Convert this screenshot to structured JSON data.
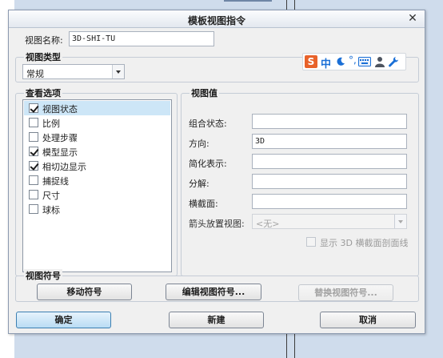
{
  "window": {
    "title": "模板视图指令",
    "close_glyph": "✕"
  },
  "view_name": {
    "label": "视图名称:",
    "value": "3D-SHI-TU"
  },
  "view_type": {
    "group_title": "视图类型",
    "selected": "常规"
  },
  "ime_toolbar": {
    "logo": "S",
    "mode": "中",
    "dot": "°,",
    "icons": [
      "sogou-logo-icon",
      "moon-icon",
      "punctuation-icon",
      "keyboard-icon",
      "user-icon",
      "wrench-icon"
    ],
    "accent": "#1a6fd6",
    "logo_color": "#e8622a"
  },
  "view_options": {
    "group_title": "查看选项",
    "items": [
      {
        "label": "视图状态",
        "checked": true,
        "selected": true
      },
      {
        "label": "比例",
        "checked": false,
        "selected": false
      },
      {
        "label": "处理步骤",
        "checked": false,
        "selected": false
      },
      {
        "label": "模型显示",
        "checked": true,
        "selected": false
      },
      {
        "label": "相切边显示",
        "checked": true,
        "selected": false
      },
      {
        "label": "捕捉线",
        "checked": false,
        "selected": false
      },
      {
        "label": "尺寸",
        "checked": false,
        "selected": false
      },
      {
        "label": "球标",
        "checked": false,
        "selected": false
      }
    ]
  },
  "view_values": {
    "group_title": "视图值",
    "fields": [
      {
        "label": "组合状态:",
        "value": ""
      },
      {
        "label": "方向:",
        "value": "3D"
      },
      {
        "label": "简化表示:",
        "value": ""
      },
      {
        "label": "分解:",
        "value": ""
      },
      {
        "label": "横截面:",
        "value": ""
      }
    ],
    "arrow_placement": {
      "label": "箭头放置视图:",
      "selected": "<无>"
    },
    "show_section_checkbox": "显示 3D 横截面剖面线"
  },
  "view_symbol": {
    "group_title": "视图符号",
    "move_button": "移动符号",
    "edit_button": "编辑视图符号...",
    "replace_button": "替换视图符号..."
  },
  "footer": {
    "ok_button": "确定",
    "new_button": "新建",
    "cancel_button": "取消"
  },
  "colors": {
    "selected_row": "#cde6f7",
    "primary_button": "#b9dcf4",
    "background_blue": "#cfdcec"
  }
}
